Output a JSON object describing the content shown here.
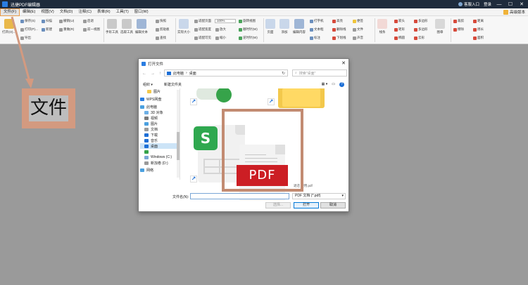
{
  "titlebar": {
    "title": "迅捷PDF编辑器",
    "login": "客服入口",
    "user": "登录",
    "minimize": "—",
    "maximize": "☐",
    "close": "✕"
  },
  "menubar": {
    "items": [
      "文件(F)",
      "编辑(E)",
      "视图(V)",
      "文档(D)",
      "注释(C)",
      "表单(R)",
      "工具(T)",
      "窗口(W)"
    ],
    "vip": "高级版本"
  },
  "ribbon": {
    "open": "打开(O)...",
    "save": "保存(S)",
    "print": "打印(P)...",
    "export": "导出",
    "scan": "扫描",
    "new": "新建",
    "undo": "撤销(U)",
    "redo": "重做(R)",
    "prev": "后退",
    "next": "前一视图",
    "hand": "手形工具",
    "select": "选取工具",
    "edit": "编辑文本",
    "snapshot": "快照",
    "clipboard": "剪贴板",
    "find": "查找",
    "actual": "实际大小",
    "fitpage": "适配页面",
    "fitwidth": "适配宽度",
    "fitvisible": "适配可见",
    "zoom": "100%",
    "zoomin": "放大",
    "zoomout": "缩小",
    "rotate": "旋转视图",
    "rotcw": "顺时针(W)",
    "rotccw": "逆时针(W)",
    "pages": "页面",
    "insert": "插入",
    "add": "添加",
    "editcontent": "编辑内容",
    "typewriter": "打字机",
    "textbox": "文本框",
    "callout": "标注",
    "highlight": "高亮",
    "strike": "删除线",
    "underline": "下划线",
    "note": "便签",
    "file": "文件",
    "sound": "声音",
    "link": "线条",
    "arrow": "箭头",
    "rect": "矩形",
    "oval": "椭圆",
    "polyline": "多边形",
    "polygon": "多边形",
    "cloud": "云形",
    "stamp": "图章",
    "crop": "裁剪",
    "erase": "擦除",
    "distance": "距离",
    "perimeter": "周长",
    "area": "面积"
  },
  "dialog": {
    "title": "打开文件",
    "close": "✕",
    "path_pc": "此电脑",
    "path_desktop": "桌面",
    "search_placeholder": "搜索\"桌面\"",
    "organize": "组织 ▾",
    "newfolder": "新建文件夹",
    "nav": [
      {
        "label": "图片",
        "color": "#f3c84b"
      },
      {
        "label": "WPS网盘",
        "color": "#2a7de1"
      },
      {
        "label": "此电脑",
        "color": "#4aa0e0"
      },
      {
        "label": "3D 对象",
        "color": "#6db0e6"
      },
      {
        "label": "视频",
        "color": "#7a7a7a"
      },
      {
        "label": "图片",
        "color": "#4aa0e0"
      },
      {
        "label": "文档",
        "color": "#9a9a9a"
      },
      {
        "label": "下载",
        "color": "#1d6fd6"
      },
      {
        "label": "音乐",
        "color": "#1d6fd6"
      },
      {
        "label": "桌面",
        "color": "#1d6fd6"
      },
      {
        "label": "",
        "color": "#36a34a"
      },
      {
        "label": "Windows (C:)",
        "color": "#7aa7d6"
      },
      {
        "label": "新加卷 (D:)",
        "color": "#9a9a9a"
      },
      {
        "label": "网络",
        "color": "#4aa0e0"
      }
    ],
    "pdf_label": "PDF",
    "pdf_file": "退还 使用.pdf",
    "filename_label": "文件名(N):",
    "filetype": "PDF 文档 (*.pdf)",
    "open_button": "打开",
    "cancel_button": "取消",
    "select_button": "选择..."
  },
  "annotation": {
    "label": "文件",
    "color": "#d39a80"
  }
}
